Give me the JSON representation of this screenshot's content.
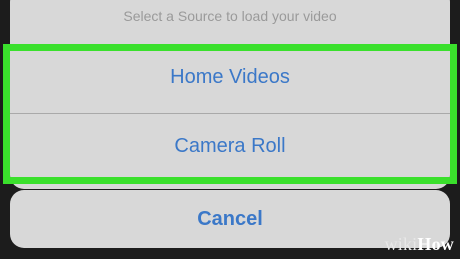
{
  "action_sheet": {
    "message": "Select a Source to load your video",
    "options": [
      {
        "label": "Home Videos"
      },
      {
        "label": "Camera Roll"
      }
    ]
  },
  "cancel_label": "Cancel",
  "watermark": {
    "wiki": "wiki",
    "how": "How"
  },
  "colors": {
    "option_text": "#3b78c8",
    "highlight": "#3ae02c",
    "sheet_background": "#d8d8d8"
  }
}
